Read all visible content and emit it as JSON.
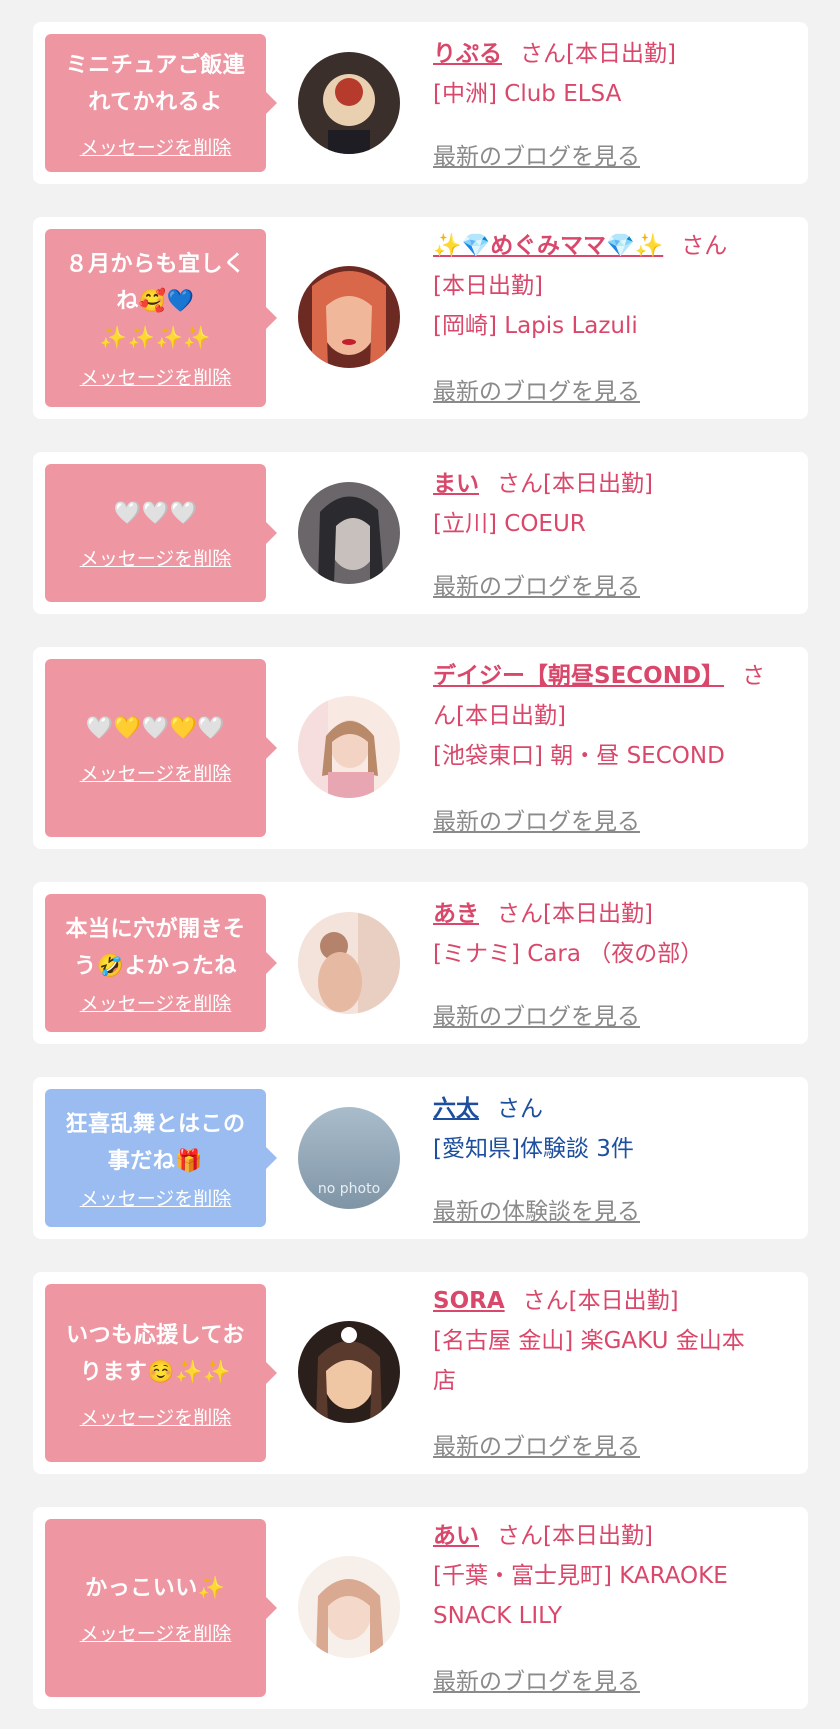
{
  "delete_label": "メッセージを削除",
  "cards": [
    {
      "message": "ミニチュアご飯連\nれてかれるよ",
      "name": "りぷる",
      "san": "さん[本日出勤]",
      "shop": "[中洲] Club ELSA",
      "more": "最新のブログを見る",
      "avatar_colors": [
        "#3a2f2a",
        "#b63b2d",
        "#e8d0b0"
      ]
    },
    {
      "message": "８月からも宜しく\nね🥰💙\n✨✨✨✨",
      "name": "✨💎めぐみママ💎✨",
      "san": "さん",
      "status_line": "[本日出勤]",
      "shop": "[岡崎] Lapis Lazuli",
      "more": "最新のブログを見る",
      "avatar_colors": [
        "#6d2a22",
        "#d9674a",
        "#f0b79a"
      ]
    },
    {
      "message": "🤍🤍🤍",
      "name": "まい",
      "san": "さん[本日出勤]",
      "shop": "[立川] COEUR",
      "more": "最新のブログを見る",
      "avatar_colors": [
        "#2b2a2e",
        "#6a6669",
        "#c7c0bd"
      ]
    },
    {
      "message": "🤍💛🤍💛🤍",
      "name": "デイジー【朝昼SECOND】",
      "san": "さ",
      "status_line": "ん[本日出勤]",
      "shop": "[池袋東口] 朝・昼 SECOND",
      "more": "最新のブログを見る",
      "avatar_colors": [
        "#f6dede",
        "#e8a6b2",
        "#f9e9e3"
      ]
    },
    {
      "message": "本当に穴が開きそ\nう🤣よかったね",
      "name": "あき",
      "san": "さん[本日出勤]",
      "shop": "[ミナミ] Cara （夜の部）",
      "more": "最新のブログを見る",
      "avatar_colors": [
        "#f3e3da",
        "#b5836b",
        "#e9cfc2"
      ]
    },
    {
      "message": "狂喜乱舞とはこの\n事だね🎁",
      "name": "六太",
      "san": "さん",
      "shop": "[愛知県]体験談 3件",
      "more": "最新の体験談を見る",
      "no_photo": "no photo"
    },
    {
      "message": "いつも応援してお\nります☺️✨✨",
      "name": "SORA",
      "san": "さん[本日出勤]",
      "shop": "[名古屋 金山] 楽GAKU 金山本\n店",
      "more": "最新のブログを見る",
      "avatar_colors": [
        "#2b1f1c",
        "#c78c69",
        "#f0c7a5"
      ]
    },
    {
      "message": "かっこいい✨",
      "name": "あい",
      "san": "さん[本日出勤]",
      "shop": "[千葉・富士見町] KARAOKE\nSNACK LILY",
      "more": "最新のブログを見る",
      "avatar_colors": [
        "#f1e4dc",
        "#d9a991",
        "#f7efe9"
      ]
    }
  ]
}
